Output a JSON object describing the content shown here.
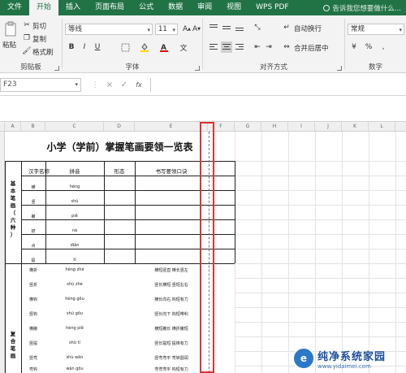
{
  "ribbon_tabs": [
    "文件",
    "开始",
    "插入",
    "页面布局",
    "公式",
    "数据",
    "审阅",
    "视图",
    "WPS PDF"
  ],
  "active_tab": "开始",
  "tell_me": "告诉我您想要做什么...",
  "clipboard": {
    "paste": "粘贴",
    "cut": "剪切",
    "copy": "复制",
    "format_painter": "格式刷",
    "label": "剪贴板"
  },
  "font": {
    "name": "等线",
    "size": "11",
    "bold": "B",
    "italic": "I",
    "underline": "U",
    "label": "字体"
  },
  "alignment": {
    "wrap": "自动换行",
    "merge": "合并后居中",
    "label": "对齐方式"
  },
  "number": {
    "format": "常规",
    "label": "数字"
  },
  "formula_bar": {
    "name_box": "F23",
    "cancel": "×",
    "confirm": "✓",
    "fx": "fx"
  },
  "columns": [
    "A",
    "B",
    "C",
    "D",
    "E",
    "F",
    "G",
    "H",
    "I",
    "J",
    "K",
    "L",
    "M"
  ],
  "sheet": {
    "title": "小学（学前）掌握笔画要领一览表",
    "headers": [
      "汉字名称",
      "拼音",
      "形态",
      "书写要领口诀"
    ],
    "group1_label": "基本笔画（六种）",
    "group2_label": "复合笔画",
    "basic_rows": [
      {
        "name": "横",
        "pinyin": "héng"
      },
      {
        "name": "竖",
        "pinyin": "shù"
      },
      {
        "name": "撇",
        "pinyin": "piě"
      },
      {
        "name": "捺",
        "pinyin": "nà"
      },
      {
        "name": "点",
        "pinyin": "diǎn"
      },
      {
        "name": "提",
        "pinyin": "tí"
      }
    ],
    "compound_rows": [
      {
        "name": "横折",
        "pinyin": "héng zhé",
        "tip": "横短竖直 横长竖左"
      },
      {
        "name": "竖折",
        "pinyin": "shù zhé",
        "tip": "竖长横短 竖短右右"
      },
      {
        "name": "横钩",
        "pinyin": "héng gōu",
        "tip": "横长向右 钩短有力"
      },
      {
        "name": "竖钩",
        "pinyin": "shù gōu",
        "tip": "竖长向下 钩短带利"
      },
      {
        "name": "横撇",
        "pinyin": "héng piě",
        "tip": "横短撇长 横折撇短"
      },
      {
        "name": "竖提",
        "pinyin": "shù tí",
        "tip": "竖长提短 提锋有力"
      },
      {
        "name": "竖弯",
        "pinyin": "shù wān",
        "tip": "竖弯弯平 弯转圆润"
      },
      {
        "name": "弯钩",
        "pinyin": "wān gōu",
        "tip": "弯弯弯平 钩短有力"
      }
    ]
  },
  "watermark": {
    "logo": "e",
    "title": "纯净系统家园",
    "url": "www.yidaimei.com"
  }
}
